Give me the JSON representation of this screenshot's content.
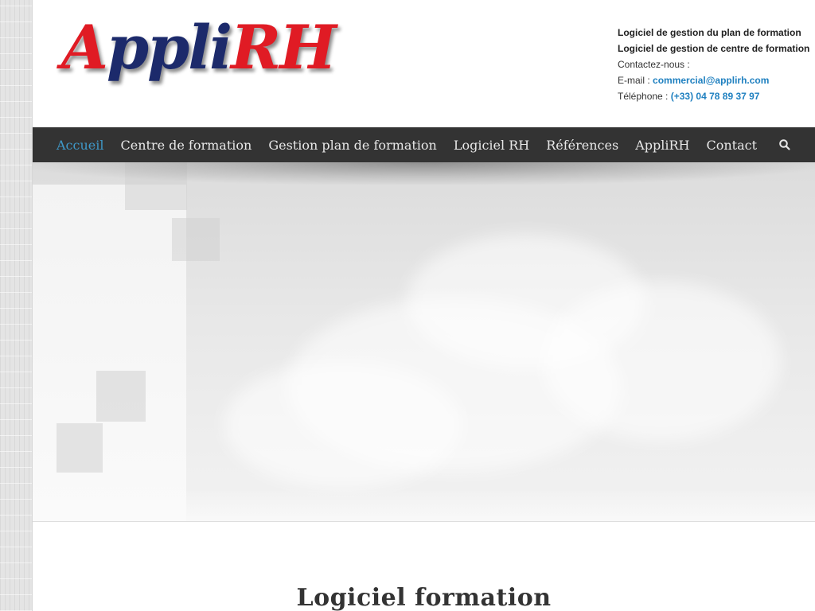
{
  "logo": {
    "part1": "A",
    "part2": "ppli",
    "part3": "RH"
  },
  "contact": {
    "line1": "Logiciel de gestion du plan de formation",
    "line2": "Logiciel de gestion de centre de formation",
    "line3": "Contactez-nous :",
    "email_label": "E-mail : ",
    "email_value": "commercial@applirh.com",
    "phone_label": "Téléphone : ",
    "phone_value": "(+33) 04 78 89 37 97"
  },
  "nav": {
    "items": [
      {
        "label": "Accueil",
        "active": true
      },
      {
        "label": "Centre de formation"
      },
      {
        "label": "Gestion plan de formation"
      },
      {
        "label": "Logiciel RH"
      },
      {
        "label": "Références"
      },
      {
        "label": "AppliRH"
      },
      {
        "label": "Contact"
      }
    ],
    "search_icon": "search-icon"
  },
  "colors": {
    "nav_bg": "#333333",
    "nav_active": "#3f98c8",
    "link": "#1f80c0",
    "logo_red": "#e01b24",
    "logo_blue": "#1c2a6b"
  },
  "content": {
    "title": "Logiciel formation"
  }
}
